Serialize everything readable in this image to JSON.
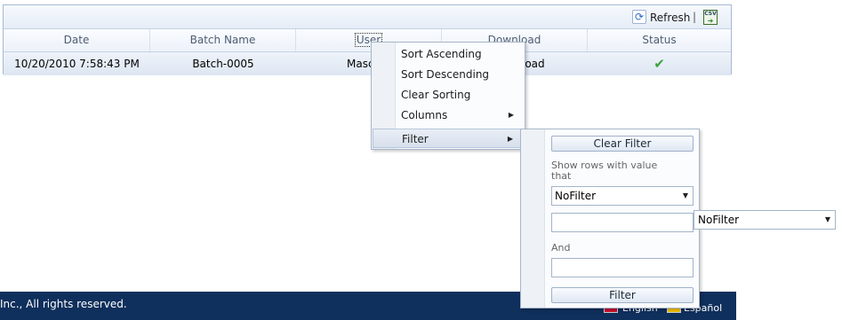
{
  "toolbar": {
    "refresh_label": "Refresh",
    "separator": "|",
    "export_icon_text": "CSV"
  },
  "grid": {
    "columns": [
      "Date",
      "Batch Name",
      "User",
      "Download",
      "Status"
    ],
    "row": {
      "date": "10/20/2010 7:58:43 PM",
      "batch_name": "Batch-0005",
      "user": "Mascare",
      "download": "load",
      "status_glyph": "✔"
    }
  },
  "context_menu": {
    "items": [
      "Sort Ascending",
      "Sort Descending",
      "Clear Sorting",
      "Columns"
    ],
    "filter_label": "Filter",
    "arrow_glyph": "▶"
  },
  "filter_menu": {
    "clear_filter": "Clear Filter",
    "show_rows_label_1": "Show rows with value",
    "show_rows_label_2": "that",
    "first_condition": "NoFilter",
    "first_value": "",
    "and_label": "And",
    "second_condition": "NoFilter",
    "second_value": "",
    "filter_button": "Filter",
    "dropdown_glyph": "▼"
  },
  "footer": {
    "copyright": "Inc., All rights reserved.",
    "lang_english": "English",
    "lang_espanol": "Español"
  },
  "colors": {
    "footer_bg": "#0f2f5c",
    "status_check": "#3aa33a",
    "grid_border": "#a6b9d3"
  }
}
